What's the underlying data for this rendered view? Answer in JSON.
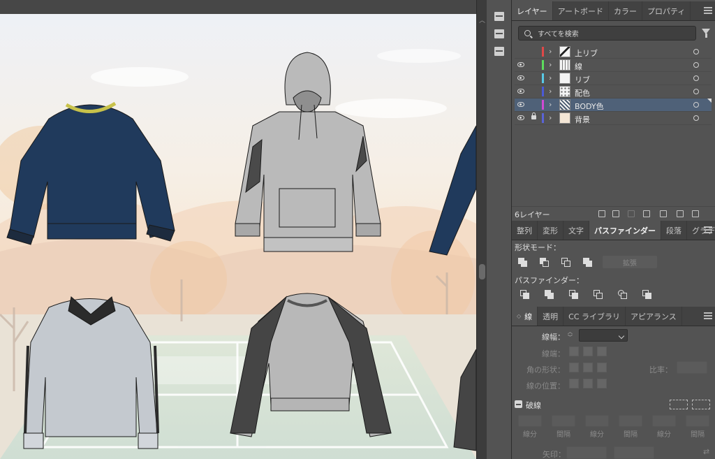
{
  "layers_panel": {
    "tabs": [
      "レイヤー",
      "アートボード",
      "カラー",
      "プロパティ"
    ],
    "active_tab": "レイヤー",
    "search_placeholder": "すべてを検索",
    "layers": [
      {
        "name": "上リブ",
        "color": "#e04848",
        "visible": false,
        "locked": false,
        "selected": false,
        "thumb": "diagonal"
      },
      {
        "name": "線",
        "color": "#5ddc5d",
        "visible": true,
        "locked": false,
        "selected": false,
        "thumb": "lines"
      },
      {
        "name": "リブ",
        "color": "#58c9e6",
        "visible": true,
        "locked": false,
        "selected": false,
        "thumb": "blank"
      },
      {
        "name": "配色",
        "color": "#4a5ad6",
        "visible": true,
        "locked": false,
        "selected": false,
        "thumb": "dots"
      },
      {
        "name": "BODY色",
        "color": "#d04ad4",
        "visible": true,
        "locked": false,
        "selected": true,
        "thumb": "pattern"
      },
      {
        "name": "背景",
        "color": "#5a63d8",
        "visible": true,
        "locked": true,
        "selected": false,
        "thumb": "beige"
      }
    ],
    "layer_count_label": "6レイヤー"
  },
  "pathfinder_panel": {
    "tabs": [
      "整列",
      "変形",
      "文字",
      "パスファインダー",
      "段落",
      "グラデーシ"
    ],
    "active_tab": "パスファインダー",
    "shape_modes_label": "形状モード：",
    "expand_button": "拡張",
    "pathfinders_label": "パスファインダー："
  },
  "stroke_panel": {
    "tabs": [
      "線",
      "透明",
      "CC ライブラリ",
      "アピアランス"
    ],
    "active_tab": "線",
    "weight_label": "線幅：",
    "cap_label": "線端：",
    "corner_label": "角の形状：",
    "limit_label": "比率：",
    "align_label": "線の位置：",
    "dashed_label": "破線",
    "dash_labels": [
      "線分",
      "間隔",
      "線分",
      "間隔",
      "線分",
      "間隔"
    ],
    "arrowheads_label": "矢印："
  },
  "canvas": {
    "garments": [
      {
        "name": "navy-zip-sweatshirt",
        "body": "#203a5c"
      },
      {
        "name": "gray-hoodie",
        "body": "#bababa"
      },
      {
        "name": "light-gray-polo-sweater",
        "body": "#c4c9cf"
      },
      {
        "name": "raglan-sweatshirt",
        "body": "#b8b8b8",
        "sleeves": "#454545"
      }
    ]
  },
  "colors": {
    "panel_bg": "#535353",
    "tabbar_bg": "#424242",
    "selection": "#4f6178"
  }
}
